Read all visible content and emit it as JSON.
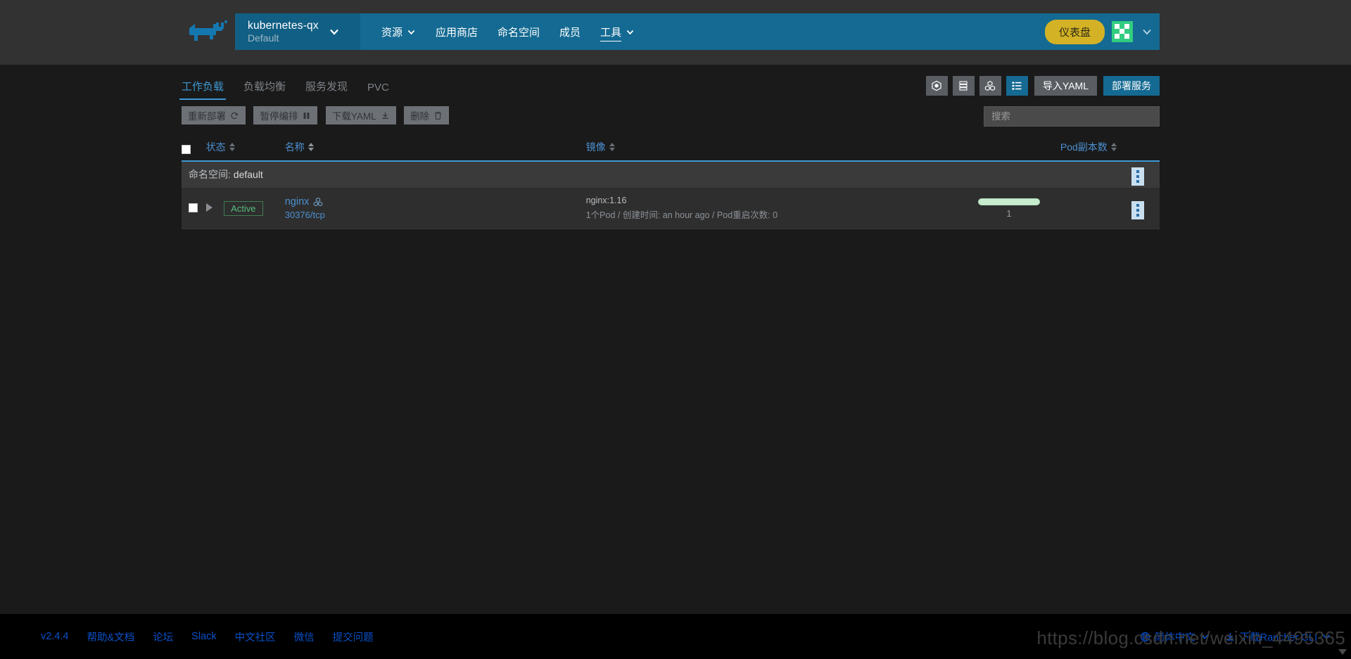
{
  "header": {
    "logo_icon": "rancher-cow-logo",
    "cluster": {
      "name": "kubernetes-qx",
      "project": "Default",
      "caret_icon": "chevron-down-icon"
    },
    "nav": [
      {
        "label": "资源",
        "icon": "chevron-down-icon",
        "has_caret": true,
        "underlined": false
      },
      {
        "label": "应用商店",
        "has_caret": false,
        "underlined": false
      },
      {
        "label": "命名空间",
        "has_caret": false,
        "underlined": false
      },
      {
        "label": "成员",
        "has_caret": false,
        "underlined": false
      },
      {
        "label": "工具",
        "icon": "chevron-down-icon",
        "has_caret": true,
        "underlined": true
      }
    ],
    "dashboard_button": "仪表盘",
    "avatar_icon": "user-avatar",
    "user_caret_icon": "chevron-down-icon",
    "colors": {
      "nav_bg": "#146a92",
      "cluster_bg": "#115f84",
      "dashboard_bg": "#d4b225",
      "avatar_bg": "#32cc80"
    }
  },
  "tabs": [
    {
      "label": "工作负载",
      "active": true
    },
    {
      "label": "负载均衡",
      "active": false
    },
    {
      "label": "服务发现",
      "active": false
    },
    {
      "label": "PVC",
      "active": false
    }
  ],
  "view_toggles": [
    {
      "icon": "cube-icon",
      "active": false
    },
    {
      "icon": "server-stack-icon",
      "active": false
    },
    {
      "icon": "workload-group-icon",
      "active": false
    },
    {
      "icon": "list-view-icon",
      "active": true
    }
  ],
  "toolbar": {
    "import_yaml": "导入YAML",
    "deploy_service": "部署服务"
  },
  "actions": [
    {
      "label": "重新部署",
      "icon": "redo-icon",
      "disabled": true
    },
    {
      "label": "暂停编排",
      "icon": "pause-icon",
      "disabled": true
    },
    {
      "label": "下载YAML",
      "icon": "download-icon",
      "disabled": true
    },
    {
      "label": "删除",
      "icon": "trash-icon",
      "disabled": true
    }
  ],
  "search": {
    "value": "",
    "placeholder": "搜索"
  },
  "table": {
    "select_all_checkbox": false,
    "columns": [
      {
        "key": "status",
        "label": "状态",
        "sorted": false
      },
      {
        "key": "name",
        "label": "名称",
        "sorted": true
      },
      {
        "key": "image",
        "label": "镜像",
        "sorted": false
      },
      {
        "key": "pods",
        "label": "Pod副本数",
        "sorted": false
      }
    ],
    "group": {
      "label": "命名空间",
      "separator": ":",
      "value": "default",
      "menu_icon": "kebab-menu-icon"
    },
    "rows": [
      {
        "checkbox": false,
        "expand_icon": "expand-triangle-icon",
        "status": "Active",
        "name": "nginx",
        "name_icon": "workload-group-icon",
        "ports": "30376/tcp",
        "image": "nginx:1.16",
        "image_detail": "1个Pod / 创建时间: an hour ago / Pod重启次数: 0",
        "pod_count": "1",
        "pod_bar_percent": 100,
        "menu_icon": "kebab-menu-icon"
      }
    ]
  },
  "footer": {
    "left_links": [
      "v2.4.4",
      "帮助&文档",
      "论坛",
      "Slack",
      "中文社区",
      "微信",
      "提交问题"
    ],
    "language": {
      "icon": "globe-icon",
      "label": "简体中文",
      "caret_icon": "chevron-down-icon"
    },
    "cli": {
      "icon": "download-icon",
      "label": "下载Rancher CLI",
      "caret_icon": "chevron-down-icon"
    }
  },
  "watermark": "https://blog.csdn.net/weixin_4495365"
}
